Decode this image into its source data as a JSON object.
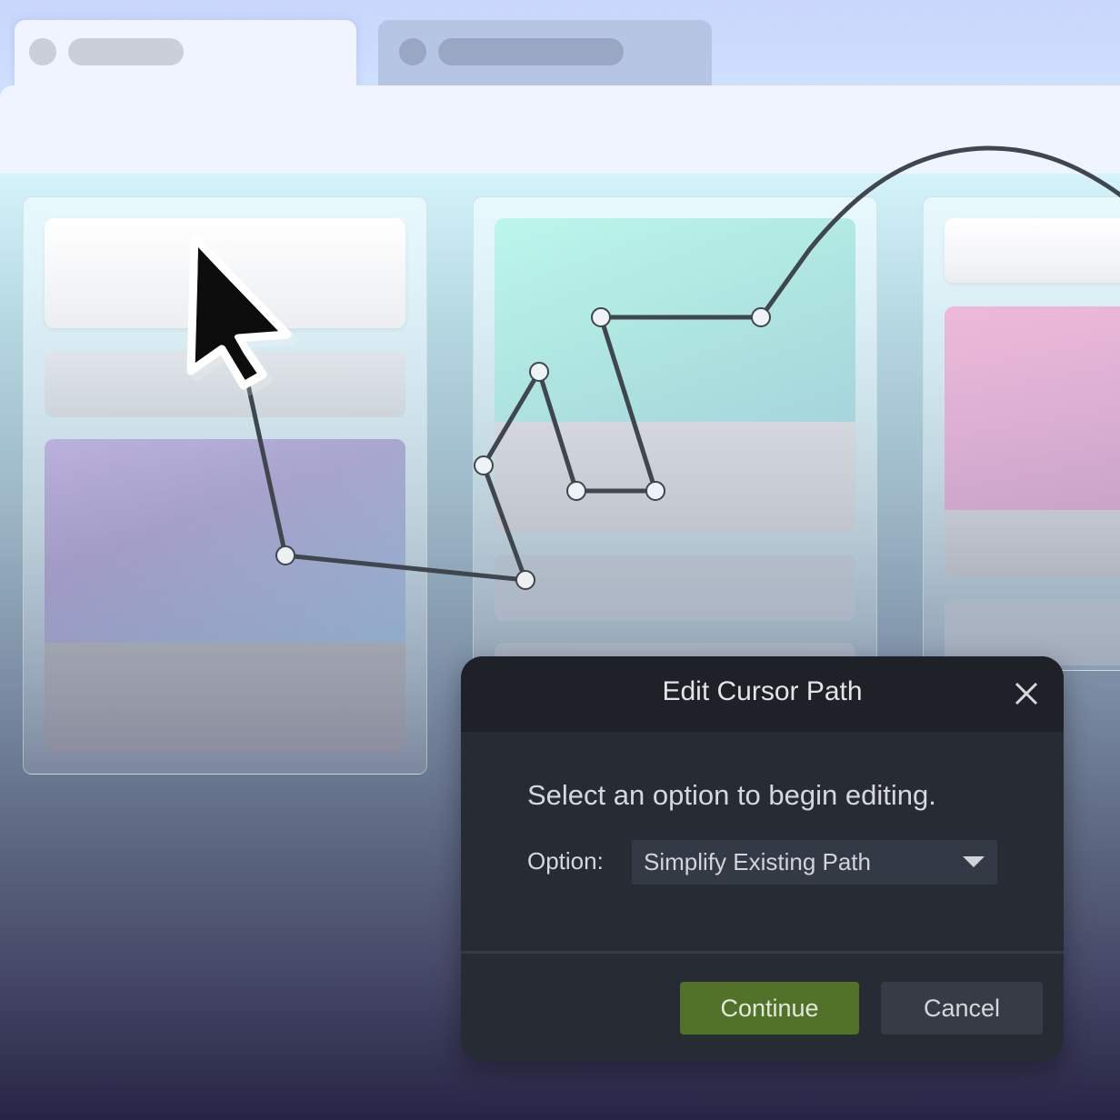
{
  "browser": {
    "tabs": [
      {
        "state": "active",
        "title_placeholder": ""
      },
      {
        "state": "inactive",
        "title_placeholder": ""
      }
    ]
  },
  "board": {
    "columns": [
      {
        "cards": [
          "plain-white",
          "plain-gray",
          "image-purple-blue"
        ]
      },
      {
        "cards": [
          "image-mint-cyan",
          "plain-gray",
          "plain-gray"
        ]
      },
      {
        "cards": [
          "plain-white",
          "image-pink-purple",
          "plain-gray"
        ]
      }
    ]
  },
  "cursor_path": {
    "icon": "arrow-cursor-icon",
    "line_color": "#3f464d",
    "node_fill": "#eef3f7",
    "node_count": 9
  },
  "dialog": {
    "title": "Edit Cursor Path",
    "close_icon": "close-icon",
    "message": "Select an option to begin editing.",
    "option_label": "Option:",
    "option_selected": "Simplify Existing Path",
    "dropdown_icon": "caret-down-icon",
    "continue_label": "Continue",
    "cancel_label": "Cancel",
    "colors": {
      "primary": "#52722a",
      "secondary": "#363b45",
      "background": "#272b33",
      "header": "#1e2128"
    }
  }
}
